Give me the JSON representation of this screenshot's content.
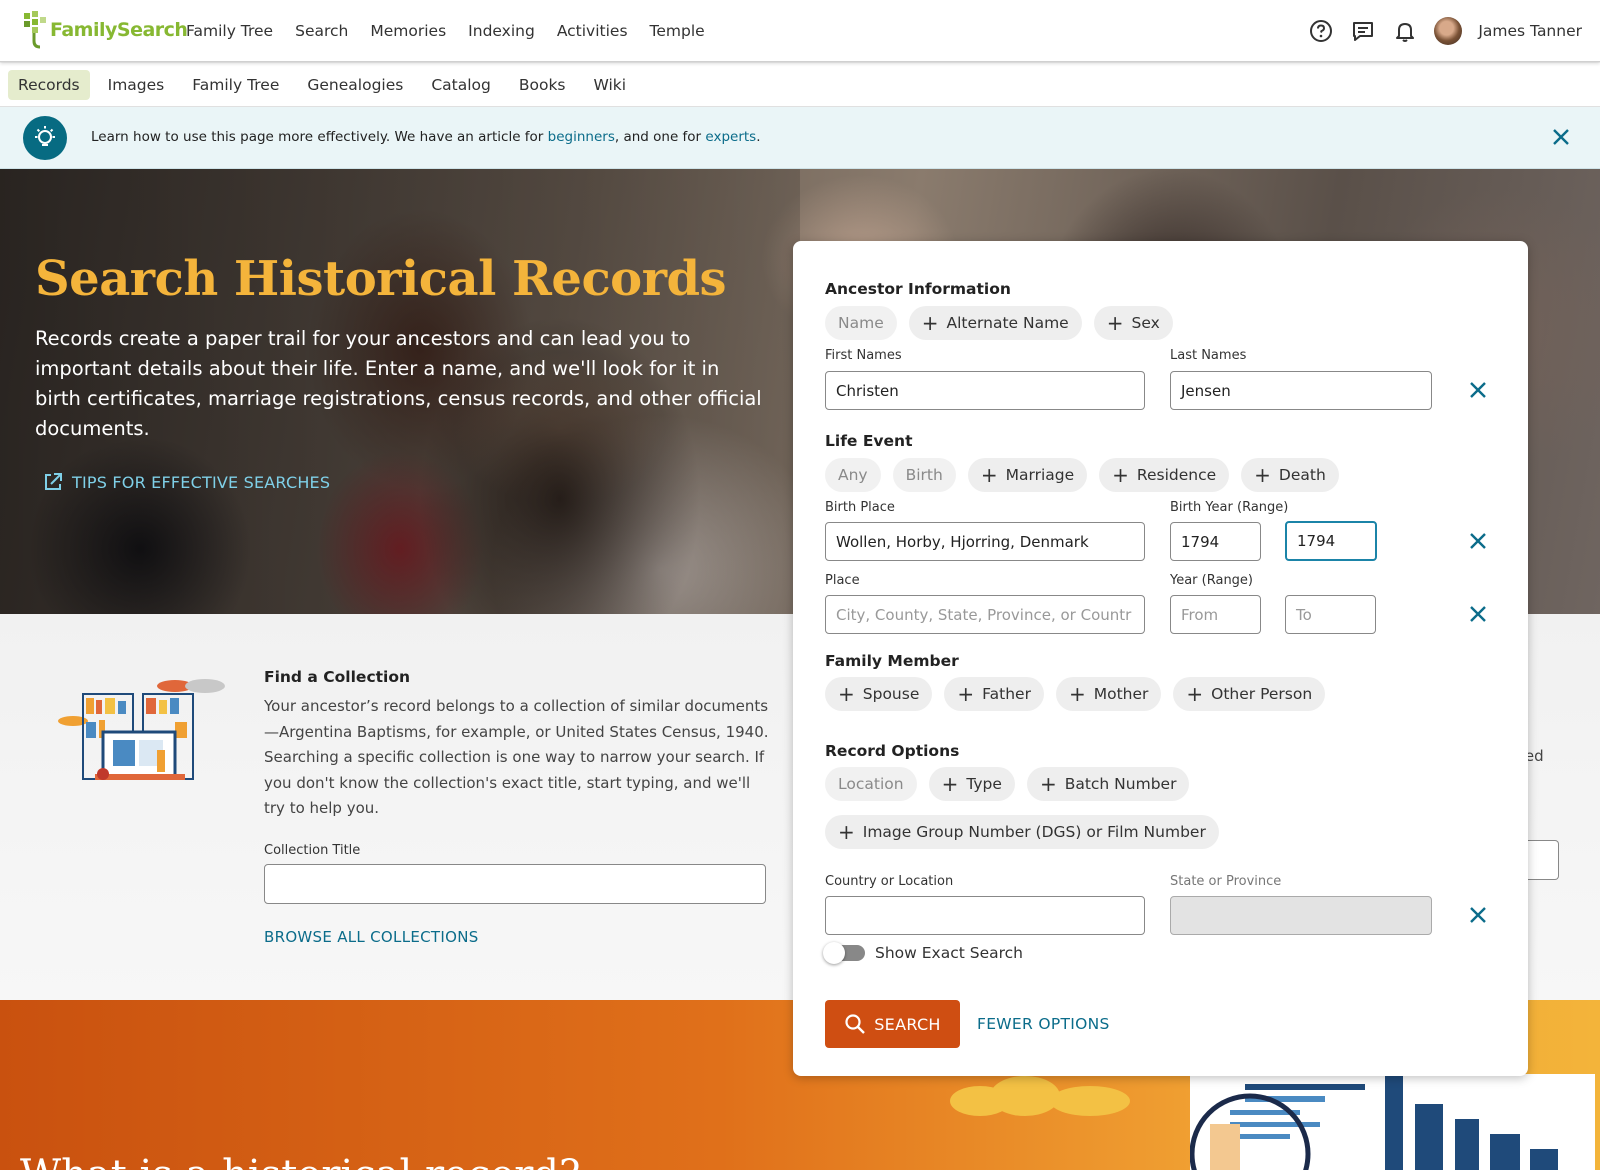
{
  "header": {
    "logo_text": "FamilySearch",
    "nav": [
      "Family Tree",
      "Search",
      "Memories",
      "Indexing",
      "Activities",
      "Temple"
    ],
    "icons": [
      "help-icon",
      "messages-icon",
      "notifications-icon"
    ],
    "user_name": "James Tanner"
  },
  "subnav": {
    "items": [
      "Records",
      "Images",
      "Family Tree",
      "Genealogies",
      "Catalog",
      "Books",
      "Wiki"
    ],
    "active": "Records"
  },
  "tip": {
    "text_before": "Learn how to use this page more effectively. We have an article for ",
    "link1": "beginners",
    "text_middle": ", and one for ",
    "link2": "experts",
    "text_after": "."
  },
  "hero": {
    "title": "Search Historical Records",
    "description": "Records create a paper trail for your ancestors and can lead you to important details about their life. Enter a name, and we'll look for it in birth certificates, marriage registrations, census records, and other official documents.",
    "tips_link": "TIPS FOR EFFECTIVE SEARCHES"
  },
  "collection": {
    "title": "Find a Collection",
    "description": "Your ancestor’s record belongs to a collection of similar documents—Argentina Baptisms, for example, or United States Census, 1940. Searching a specific collection is one way to narrow your search. If you don't know the collection's exact title, start typing, and we'll try to help you.",
    "input_label": "Collection Title",
    "input_value": "",
    "browse_link": "BROWSE ALL COLLECTIONS",
    "side_fragment": "ved"
  },
  "form": {
    "ancestor": {
      "title": "Ancestor Information",
      "chips": [
        "Name",
        "Alternate Name",
        "Sex"
      ],
      "first_label": "First Names",
      "first_value": "Christen",
      "last_label": "Last Names",
      "last_value": "Jensen"
    },
    "life_event": {
      "title": "Life Event",
      "chips": [
        "Any",
        "Birth",
        "Marriage",
        "Residence",
        "Death"
      ],
      "birth_place_label": "Birth Place",
      "birth_place_value": "Wollen, Horby, Hjorring, Denmark",
      "birth_year_label": "Birth Year (Range)",
      "birth_year_from": "1794",
      "birth_year_to": "1794",
      "place_label": "Place",
      "place_placeholder": "City, County, State, Province, or Countr",
      "year_label": "Year (Range)",
      "year_from_placeholder": "From",
      "year_to_placeholder": "To"
    },
    "family": {
      "title": "Family Member",
      "chips": [
        "Spouse",
        "Father",
        "Mother",
        "Other Person"
      ]
    },
    "record_options": {
      "title": "Record Options",
      "chips": [
        "Location",
        "Type",
        "Batch Number"
      ],
      "chip_wide": "Image Group Number (DGS) or Film Number",
      "country_label": "Country or Location",
      "country_value": "",
      "state_label": "State or Province"
    },
    "exact_toggle": "Show Exact Search",
    "exact_on": false,
    "search_button": "SEARCH",
    "fewer_link": "FEWER OPTIONS"
  },
  "bottom": {
    "title": "What is a historical record?"
  },
  "colors": {
    "accent": "#0b6c8a",
    "hero_title": "#f4b43b",
    "search_button": "#cf4e12",
    "logo_green": "#87b832"
  }
}
